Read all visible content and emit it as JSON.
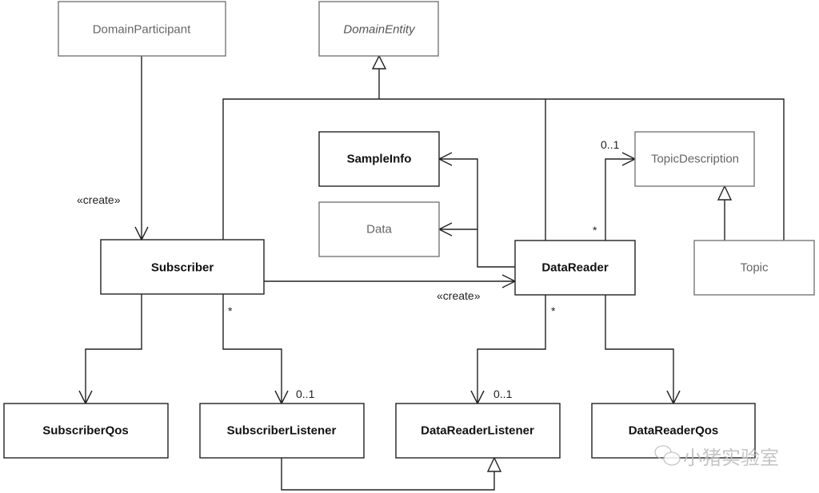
{
  "classes": {
    "domain_participant": "DomainParticipant",
    "domain_entity": "DomainEntity",
    "sample_info": "SampleInfo",
    "data": "Data",
    "topic_description": "TopicDescription",
    "subscriber": "Subscriber",
    "data_reader": "DataReader",
    "topic": "Topic",
    "subscriber_qos": "SubscriberQos",
    "subscriber_listener": "SubscriberListener",
    "data_reader_listener": "DataReaderListener",
    "data_reader_qos": "DataReaderQos"
  },
  "labels": {
    "create_1": "«create»",
    "create_2": "«create»",
    "dr_topic_mult_target": "0..1",
    "dr_topic_mult_source": "*",
    "sub_listener_mult_source": "*",
    "sub_listener_mult_target": "0..1",
    "dr_listener_mult_source": "*",
    "dr_listener_mult_target": "0..1"
  },
  "watermark": {
    "text": "小猪实验室",
    "icon": "wechat-icon"
  }
}
